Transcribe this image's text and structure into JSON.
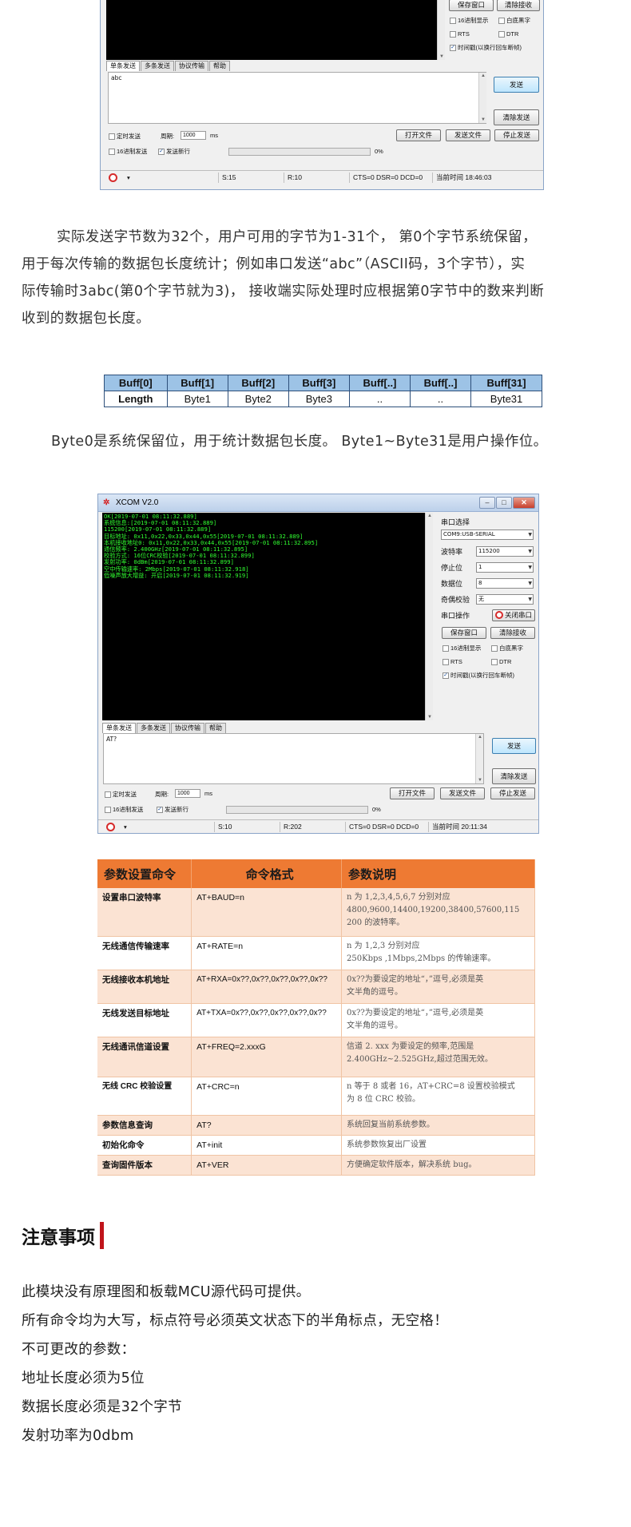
{
  "xcom1": {
    "buttons": {
      "save_window": "保存窗口",
      "clear_recv": "清除接收",
      "send": "发送",
      "clear_send": "清除发送",
      "open_file": "打开文件",
      "send_file": "发送文件",
      "stop_send": "停止发送"
    },
    "checks": {
      "hex_display": "16进制显示",
      "white_black": "白底黑字",
      "rts": "RTS",
      "dtr": "DTR",
      "timestamp": "时间戳(以换行回车断帧)",
      "timed_send": "定时发送",
      "hex_send": "16进制发送",
      "send_newline": "发送新行"
    },
    "tabs": [
      "单条发送",
      "多条发送",
      "协议传输",
      "帮助"
    ],
    "send_text": "abc",
    "period_label": "周期:",
    "period_value": "1000",
    "period_unit": "ms",
    "progress_text": "0%",
    "status": {
      "s": "S:15",
      "r": "R:10",
      "lines": "CTS=0 DSR=0 DCD=0",
      "time": "当前时间 18:46:03"
    }
  },
  "para1": {
    "lines": [
      "实际发送字节数为32个，用户可用的字节为1-31个， 第0个字节系统保留，",
      "用于每次传输的数据包长度统计；例如串口发送“abc”（ASCII码，3个字节），实",
      "际传输时3abc(第0个字节就为3)， 接收端实际处理时应根据第0字节中的数来判断",
      "收到的数据包长度。"
    ]
  },
  "buff_table": {
    "headers": [
      "Buff[0]",
      "Buff[1]",
      "Buff[2]",
      "Buff[3]",
      "Buff[..]",
      "Buff[..]",
      "Buff[31]"
    ],
    "cells": [
      "Length",
      "Byte1",
      "Byte2",
      "Byte3",
      "..",
      "..",
      "Byte31"
    ],
    "highlight_color": "#e01d1d"
  },
  "para2": "Byte0是系统保留位，用于统计数据包长度。 Byte1~Byte31是用户操作位。",
  "xcom2": {
    "title": "XCOM V2.0",
    "terminal_lines": [
      "OK[2019-07-01 08:11:32.889]",
      "系统信息:[2019-07-01 08:11:32.889]",
      "115200[2019-07-01 08:11:32.889]",
      "目标地址: 0x11,0x22,0x33,0x44,0x55[2019-07-01 08:11:32.889]",
      "本机接收地址0: 0x11,0x22,0x33,0x44,0x55[2019-07-01 08:11:32.895]",
      "通信频率: 2.400GHz[2019-07-01 08:11:32.895]",
      "校验方式: 16位CRC校验[2019-07-01 08:11:32.899]",
      "发射功率: 0dBm[2019-07-01 08:11:32.899]",
      "空中传输速率: 2Mbps[2019-07-01 08:11:32.918]",
      "低噪声放大增益: 开启[2019-07-01 08:11:32.919]"
    ],
    "side": {
      "port_select": "串口选择",
      "port_value": "COM9:USB-SERIAL",
      "baud_label": "波特率",
      "baud_value": "115200",
      "stop_label": "停止位",
      "stop_value": "1",
      "data_label": "数据位",
      "data_value": "8",
      "parity_label": "奇偶校验",
      "parity_value": "无",
      "op_label": "串口操作",
      "close_port": "关闭串口"
    },
    "buttons": {
      "save_window": "保存窗口",
      "clear_recv": "清除接收",
      "send": "发送",
      "clear_send": "清除发送",
      "open_file": "打开文件",
      "send_file": "发送文件",
      "stop_send": "停止发送"
    },
    "checks": {
      "hex_display": "16进制显示",
      "white_black": "白底黑字",
      "rts": "RTS",
      "dtr": "DTR",
      "timestamp": "时间戳(以换行回车断帧)",
      "timed_send": "定时发送",
      "hex_send": "16进制发送",
      "send_newline": "发送新行"
    },
    "tabs": [
      "单条发送",
      "多条发送",
      "协议传输",
      "帮助"
    ],
    "send_text": "AT?",
    "period_label": "周期:",
    "period_value": "1000",
    "period_unit": "ms",
    "progress_text": "0%",
    "status": {
      "s": "S:10",
      "r": "R:202",
      "lines": "CTS=0 DSR=0 DCD=0",
      "time": "当前时间 20:11:34"
    }
  },
  "at_table": {
    "headers": [
      "参数设置命令",
      "命令格式",
      "参数说明"
    ],
    "rows": [
      {
        "name": "设置串口波特率",
        "cmd": "AT+BAUD=n",
        "desc": [
          "n 为 1,2,3,4,5,6,7 分别对应",
          "4800,9600,14400,19200,38400,57600,115",
          "200 的波特率。"
        ]
      },
      {
        "name": "无线通信传输速率",
        "cmd": "AT+RATE=n",
        "desc": [
          "n 为 1,2,3 分别对应",
          "250Kbps ,1Mbps,2Mbps 的传输速率。"
        ]
      },
      {
        "name": "无线接收本机地址",
        "cmd": "AT+RXA=0x??,0x??,0x??,0x??,0x??",
        "desc": [
          "0x??为要设定的地址“，”逗号,必须是英",
          "文半角的逗号。"
        ]
      },
      {
        "name": "无线发送目标地址",
        "cmd": "AT+TXA=0x??,0x??,0x??,0x??,0x??",
        "desc": [
          "0x??为要设定的地址“，”逗号,必须是英",
          "文半角的逗号。"
        ]
      },
      {
        "name": "无线通讯信道设置",
        "cmd": "AT+FREQ=2.xxxG",
        "desc": [
          "信道 2. xxx 为要设定的频率,范围是",
          "2.400GHz~2.525GHz,超过范围无效。"
        ]
      },
      {
        "name": "无线 CRC 校验设置",
        "cmd": "AT+CRC=n",
        "desc": [
          "n 等于 8 或者 16，AT+CRC=8 设置校验模式",
          "为 8 位 CRC 校验。"
        ]
      },
      {
        "name": "参数信息查询",
        "cmd": "AT?",
        "desc": [
          "系统回复当前系统参数。"
        ]
      },
      {
        "name": "初始化命令",
        "cmd": "AT+init",
        "desc": [
          "系统参数恢复出厂设置"
        ]
      },
      {
        "name": "查询固件版本",
        "cmd": "AT+VER",
        "desc": [
          "方便确定软件版本，解决系统 bug。"
        ]
      }
    ]
  },
  "notes": {
    "title": "注意事项",
    "bar_color": "#c0141b",
    "lines": [
      "此模块没有原理图和板载MCU源代码可提供。",
      "所有命令均为大写，标点符号必须英文状态下的半角标点，无空格！",
      "不可更改的参数：",
      "地址长度必须为5位",
      "数据长度必须是32个字节",
      "发射功率为0dbm"
    ]
  }
}
